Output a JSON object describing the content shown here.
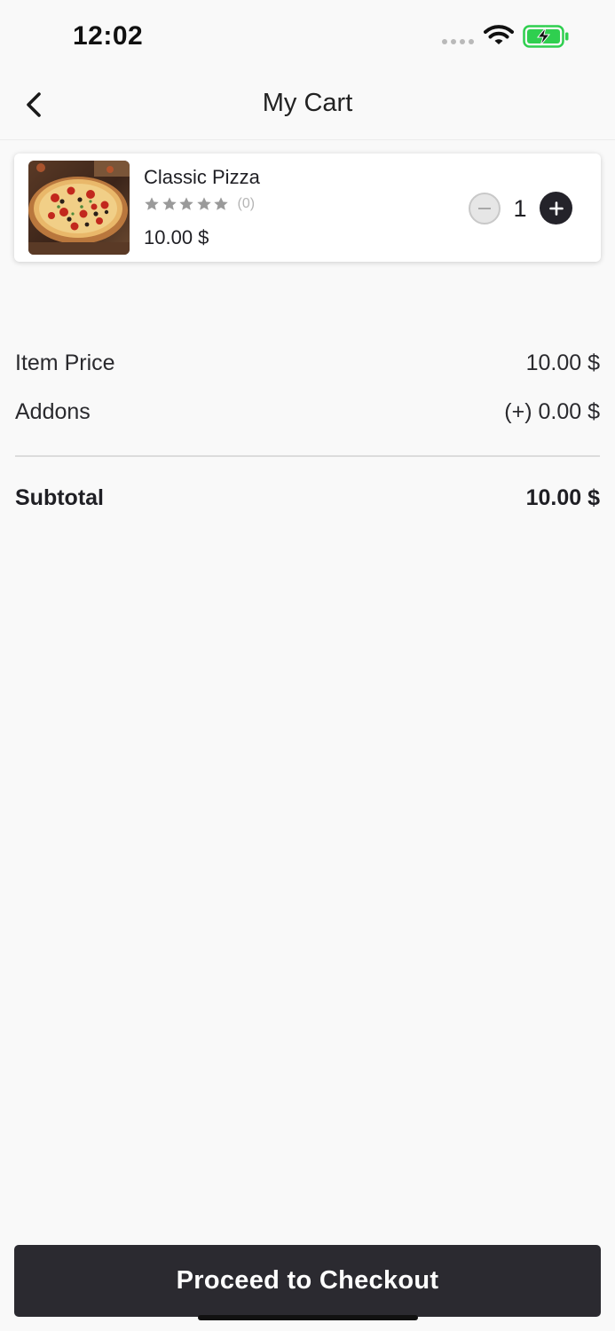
{
  "status_bar": {
    "time": "12:02"
  },
  "header": {
    "title": "My Cart"
  },
  "cart_items": [
    {
      "name": "Classic Pizza",
      "rating_count": "(0)",
      "stars": 0,
      "price": "10.00 $",
      "quantity": "1",
      "image": "pizza-image"
    }
  ],
  "summary": {
    "item_price_label": "Item Price",
    "item_price_value": "10.00 $",
    "addons_label": "Addons",
    "addons_value": "(+) 0.00 $",
    "subtotal_label": "Subtotal",
    "subtotal_value": "10.00 $"
  },
  "checkout": {
    "label": "Proceed to Checkout"
  },
  "colors": {
    "background": "#f9f9f9",
    "primary_dark": "#2b2a30",
    "star_inactive": "#9a9a9a",
    "battery_green": "#2fcf4f"
  },
  "icons": [
    "back-chevron-icon",
    "wifi-icon",
    "battery-charging-icon",
    "star-icon",
    "minus-icon",
    "plus-icon"
  ]
}
